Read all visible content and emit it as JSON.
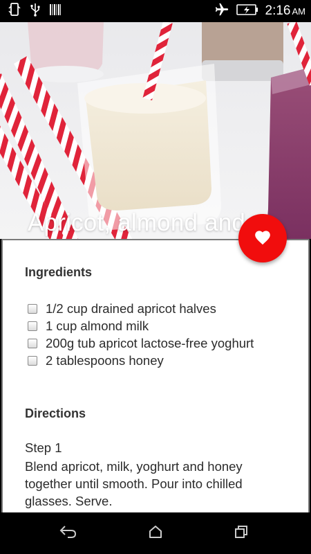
{
  "status_bar": {
    "time": "2:16",
    "ampm": "AM",
    "icons": [
      "phone-sync-icon",
      "usb-icon",
      "barcode-icon",
      "airplane-mode-icon",
      "battery-charging-icon"
    ]
  },
  "recipe": {
    "title": "Apricot, almond and…",
    "favorite_icon": "heart-icon",
    "ingredients_heading": "Ingredients",
    "ingredients": [
      "1/2 cup drained apricot halves",
      "1 cup almond milk",
      "200g tub apricot lactose-free yoghurt",
      "2 tablespoons honey"
    ],
    "directions_heading": "Directions",
    "steps": [
      {
        "label": "Step 1",
        "text": "Blend apricot, milk, yoghurt and honey together until smooth. Pour into chilled glasses. Serve."
      }
    ]
  },
  "nav_bar": {
    "buttons": [
      "back-icon",
      "home-icon",
      "recents-icon"
    ]
  },
  "colors": {
    "accent": "#f10d0d",
    "status_bar": "#000000",
    "card_border": "#7a7a7a"
  }
}
